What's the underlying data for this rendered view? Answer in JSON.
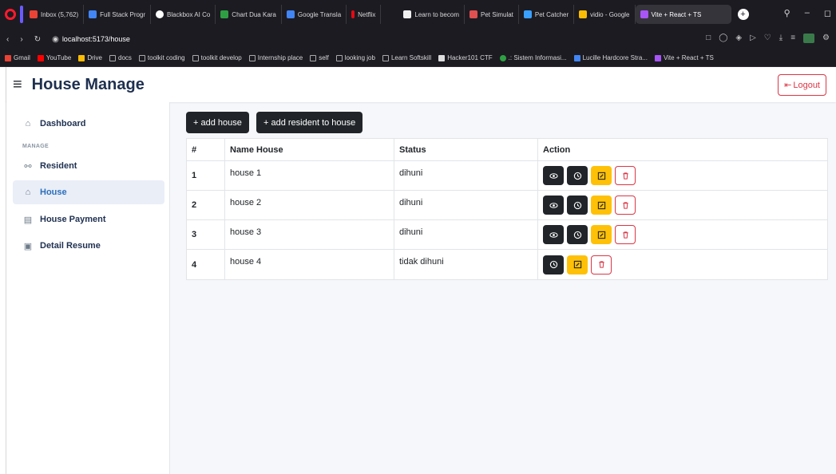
{
  "browser": {
    "tabs": [
      {
        "label": "Inbox (5,762)",
        "color": "#ea4335"
      },
      {
        "label": "Full Stack Progr",
        "color": "#4285f4"
      },
      {
        "label": "Blackbox AI Co",
        "color": "#ffffff"
      },
      {
        "label": "Chart Dua Kara",
        "color": "#2ea043"
      },
      {
        "label": "Google Transla",
        "color": "#4285f4"
      },
      {
        "label": "Netflix",
        "color": "#e50914"
      },
      {
        "label": "Learn to becom",
        "color": "#f0f0f0"
      },
      {
        "label": "Pet Simulat",
        "color": "#e05050"
      },
      {
        "label": "Pet Catcher",
        "color": "#3aa0ff"
      },
      {
        "label": "vidio - Google",
        "color": "#fbbc04"
      },
      {
        "label": "Vite + React + TS",
        "color": "#a855f7"
      }
    ],
    "url": "localhost:5173/house",
    "bookmarks": [
      {
        "label": "Gmail",
        "color": "#ea4335"
      },
      {
        "label": "YouTube",
        "color": "#ff0000"
      },
      {
        "label": "Drive",
        "color": "#fbbc04"
      },
      {
        "label": "docs",
        "color": "#888888"
      },
      {
        "label": "toolkit coding",
        "color": "#888888"
      },
      {
        "label": "toolkit develop",
        "color": "#888888"
      },
      {
        "label": "Internship place",
        "color": "#888888"
      },
      {
        "label": "self",
        "color": "#888888"
      },
      {
        "label": "looking job",
        "color": "#888888"
      },
      {
        "label": "Learn Softskill",
        "color": "#888888"
      },
      {
        "label": "Hacker101 CTF",
        "color": "#dddddd"
      },
      {
        "label": ".: Sistem Informasi...",
        "color": "#2ea043"
      },
      {
        "label": "Lucille Hardcore Stra...",
        "color": "#4285f4"
      },
      {
        "label": "Vite + React + TS",
        "color": "#a855f7"
      }
    ]
  },
  "header": {
    "title": "House Manage",
    "logout": "Logout"
  },
  "sidebar": {
    "section": "MANAGE",
    "items": [
      {
        "label": "Dashboard",
        "icon": "home-icon"
      },
      {
        "label": "Resident",
        "icon": "user-icon"
      },
      {
        "label": "House",
        "icon": "home-icon"
      },
      {
        "label": "House Payment",
        "icon": "wallet-icon"
      },
      {
        "label": "Detail Resume",
        "icon": "document-icon"
      }
    ]
  },
  "toolbar": {
    "add_house": "+ add house",
    "add_resident": "+ add resident to house"
  },
  "table": {
    "headers": [
      "#",
      "Name House",
      "Status",
      "Action"
    ],
    "rows": [
      {
        "no": "1",
        "name": "house 1",
        "status": "dihuni"
      },
      {
        "no": "2",
        "name": "house 2",
        "status": "dihuni"
      },
      {
        "no": "3",
        "name": "house 3",
        "status": "dihuni"
      },
      {
        "no": "4",
        "name": "house 4",
        "status": "tidak dihuni"
      }
    ]
  },
  "colors": {
    "primary": "#1e3050",
    "danger": "#dc3545",
    "warning": "#ffc107",
    "dark": "#212529"
  }
}
